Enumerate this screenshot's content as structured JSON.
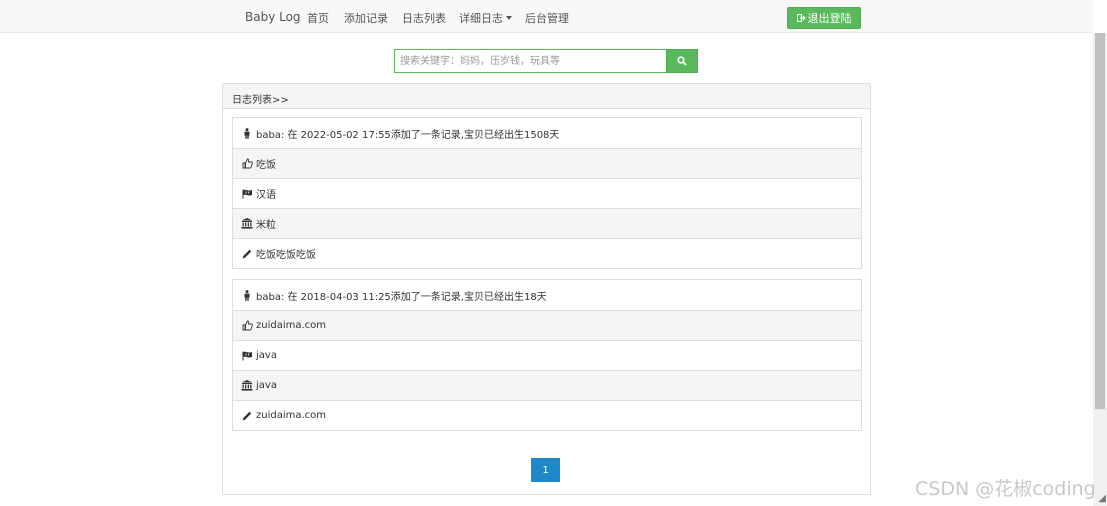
{
  "navbar": {
    "brand": "Baby Log",
    "items": [
      {
        "label": "首页"
      },
      {
        "label": "添加记录"
      },
      {
        "label": "日志列表"
      },
      {
        "label": "详细日志"
      },
      {
        "label": "后台管理"
      }
    ],
    "logout_label": "退出登陆"
  },
  "search": {
    "placeholder": "搜索关键字：妈妈，压岁钱，玩具等",
    "button_icon": "search-icon"
  },
  "panel": {
    "heading": "日志列表>>"
  },
  "logs": [
    {
      "header": "baba: 在 2022-05-02 17:55添加了一条记录,宝贝已经出生1508天",
      "rows": [
        {
          "icon": "thumbs-up-icon",
          "text": "吃饭"
        },
        {
          "icon": "flag-icon",
          "text": "汉语"
        },
        {
          "icon": "bank-icon",
          "text": "米粒"
        },
        {
          "icon": "pencil-icon",
          "text": "吃饭吃饭吃饭"
        }
      ]
    },
    {
      "header": "baba: 在 2018-04-03 11:25添加了一条记录,宝贝已经出生18天",
      "rows": [
        {
          "icon": "thumbs-up-icon",
          "text": "zuidaima.com"
        },
        {
          "icon": "flag-icon",
          "text": "java"
        },
        {
          "icon": "bank-icon",
          "text": "java"
        },
        {
          "icon": "pencil-icon",
          "text": "zuidaima.com"
        }
      ]
    }
  ],
  "pagination": {
    "current": "1"
  },
  "watermark": "CSDN @花椒coding",
  "colors": {
    "accent_green": "#5cb85c",
    "pager_blue": "#1e88c9"
  }
}
